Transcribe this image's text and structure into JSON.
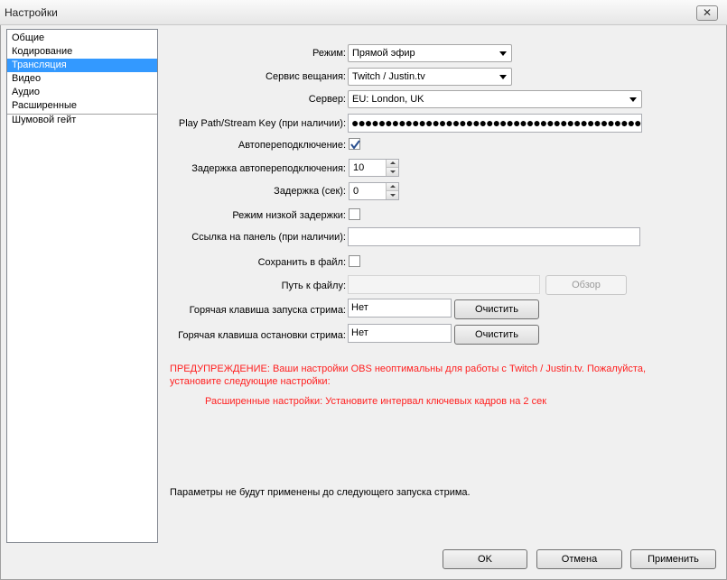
{
  "window": {
    "title": "Настройки",
    "close_glyph": "✕"
  },
  "sidebar": {
    "items": [
      {
        "label": "Общие"
      },
      {
        "label": "Кодирование"
      },
      {
        "label": "Трансляция"
      },
      {
        "label": "Видео"
      },
      {
        "label": "Аудио"
      },
      {
        "label": "Расширенные"
      },
      {
        "label": "Шумовой гейт"
      }
    ],
    "selected": "Трансляция"
  },
  "form": {
    "mode_label": "Режим:",
    "mode_value": "Прямой эфир",
    "service_label": "Сервис вещания:",
    "service_value": "Twitch / Justin.tv",
    "server_label": "Сервер:",
    "server_value": "EU: London, UK",
    "stream_key_label": "Play Path/Stream Key (при наличии):",
    "stream_key_value": "●●●●●●●●●●●●●●●●●●●●●●●●●●●●●●●●●●●●●●●●●●●●●●●●●●●●●●●●●●●●●●●●",
    "auto_reconnect_label": "Автопереподключение:",
    "auto_reconnect_checked": true,
    "reconnect_delay_label": "Задержка автопереподключения:",
    "reconnect_delay_value": "10",
    "delay_label": "Задержка (сек):",
    "delay_value": "0",
    "low_latency_label": "Режим низкой задержки:",
    "low_latency_checked": false,
    "dashboard_label": "Ссылка на панель (при наличии):",
    "dashboard_value": "",
    "save_to_file_label": "Сохранить в файл:",
    "save_to_file_checked": false,
    "file_path_label": "Путь к файлу:",
    "file_path_value": "",
    "browse_label": "Обзор",
    "start_hotkey_label": "Горячая клавиша запуска стрима:",
    "start_hotkey_value": "Нет",
    "stop_hotkey_label": "Горячая клавиша остановки стрима:",
    "stop_hotkey_value": "Нет",
    "clear_label": "Очистить"
  },
  "warnings": {
    "main": "ПРЕДУПРЕЖДЕНИЕ: Ваши настройки OBS неоптимальны для работы с Twitch / Justin.tv. Пожалуйста, установите следующие настройки:",
    "advanced": "Расширенные настройки: Установите интервал ключевых кадров на 2 сек",
    "color": "#ff2020"
  },
  "note": "Параметры не будут применены до следующего запуска стрима.",
  "footer": {
    "ok_label": "OK",
    "cancel_label": "Отмена",
    "apply_label": "Применить"
  },
  "colors": {
    "selection": "#3399ff",
    "window_bg": "#f0f0f0"
  }
}
